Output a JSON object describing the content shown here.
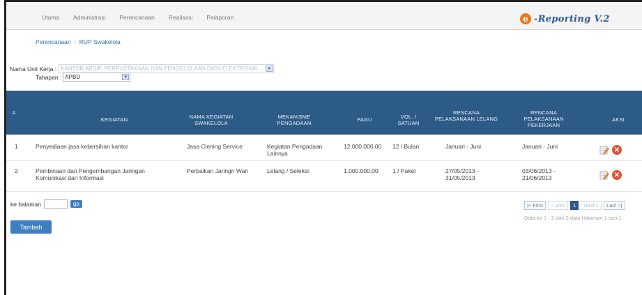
{
  "nav": {
    "items": [
      "Utama",
      "Administrasi",
      "Perencanaan",
      "Realisasi",
      "Pelaporan"
    ]
  },
  "logo": {
    "mark": "e",
    "text": "-Reporting V.2"
  },
  "breadcrumb": {
    "items": [
      "Perencanaan",
      "RUP Swakelola"
    ]
  },
  "filters": {
    "unit_label": "Nama Unit Kerja :",
    "unit_value": "KANTOR ARSIP, PERPUSTAKAAN DAN PENGELOLAAN DATA ELEKTRONIK",
    "tahapan_label": "Tahapan :",
    "tahapan_value": "APBD"
  },
  "table": {
    "headers": {
      "no": "#",
      "kegiatan": "KEGIATAN",
      "nama": "NAMA KEGIATAN SWAKELOLA",
      "mekanisme": "MEKANISME PENGADAAN",
      "pagu": "PAGU",
      "vol": "VOL. / SATUAN",
      "lelang": "RENCANA PELAKSANAAN LELANG",
      "pekerjaan": "RENCANA PELAKSANAAN PEKERJAAN",
      "aksi": "AKSI"
    },
    "rows": [
      {
        "no": "1",
        "kegiatan": "Penyediaan jasa kebersihan kantor",
        "nama": "Jasa Clening Service",
        "mekanisme": "Kegiatan Pengadaan Lainnya",
        "pagu": "12.000.000,00",
        "vol": "12 / Bulan",
        "lelang": "Januari - Juni",
        "pekerjaan": "Januari - Juni"
      },
      {
        "no": "2",
        "kegiatan": "Pembinaan dan Pengembangan Jaringan Komunikasi dan Informasi",
        "nama": "Perbaikan Jaringn Wan",
        "mekanisme": "Lelang / Seleksi",
        "pagu": "1.000.000,00",
        "vol": "1 / Paket",
        "lelang": "27/05/2013 - 31/05/2013",
        "pekerjaan": "03/06/2013 - 21/06/2013"
      }
    ]
  },
  "pagination": {
    "jump_label": "ke halaman",
    "go_label": "go",
    "first": "|< First",
    "prev": "< prev",
    "current": "1",
    "next": "Next >",
    "last": "Last >|",
    "info": "Data ke 1 - 2 dari 2 data Halaman 1 dari 1"
  },
  "actions": {
    "add_label": "Tambah"
  },
  "colors": {
    "header_bg": "#2d5b87",
    "accent": "#3e7fc1",
    "delete": "#e05234",
    "logo_orange": "#e87a1e"
  },
  "icons": {
    "edit": "edit-icon",
    "delete": "delete-icon"
  }
}
